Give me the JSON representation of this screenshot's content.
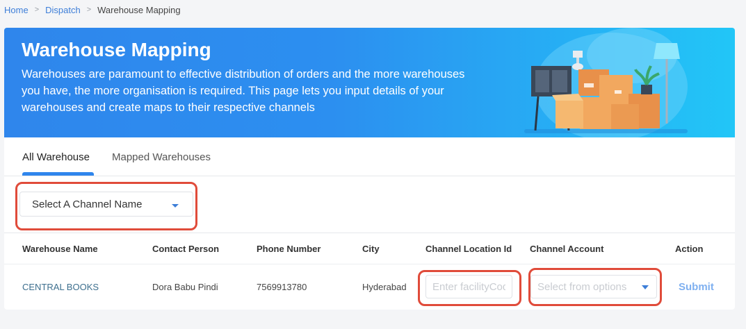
{
  "breadcrumb": {
    "home": "Home",
    "dispatch": "Dispatch",
    "current": "Warehouse Mapping",
    "separator": ">"
  },
  "hero": {
    "title": "Warehouse Mapping",
    "description": "Warehouses are paramount to effective distribution of orders and the more warehouses you have, the more organisation is required. This page lets you input details of your warehouses and create maps to their respective channels"
  },
  "tabs": {
    "all": "All Warehouse",
    "mapped": "Mapped Warehouses"
  },
  "filter": {
    "channel_placeholder": "Select A Channel Name"
  },
  "table": {
    "headers": {
      "name": "Warehouse Name",
      "contact": "Contact Person",
      "phone": "Phone Number",
      "city": "City",
      "location_id": "Channel Location Id",
      "account": "Channel Account",
      "action": "Action"
    },
    "rows": [
      {
        "name": "CENTRAL BOOKS",
        "contact": "Dora Babu Pindi",
        "phone": "7569913780",
        "city": "Hyderabad",
        "location_placeholder": "Enter facilityCode",
        "account_placeholder": "Select from options",
        "action": "Submit"
      }
    ]
  },
  "colors": {
    "accent": "#2f86ec",
    "highlight": "#e04b3a",
    "hero_end": "#22c6f7"
  }
}
